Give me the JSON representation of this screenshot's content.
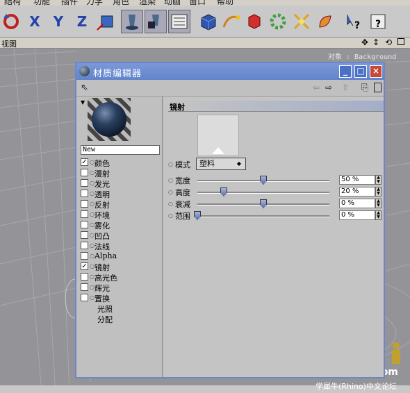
{
  "menubar": {
    "items": [
      "结构",
      "功能",
      "插件",
      "力学",
      "角色",
      "渲染",
      "动画",
      "窗口",
      "帮助"
    ]
  },
  "toolbar": {
    "axis_x": "X",
    "axis_y": "Y",
    "axis_z": "Z"
  },
  "viewbar": {
    "label": "视图"
  },
  "viewport": {
    "object_label": "对象 : Background"
  },
  "material_editor": {
    "title": "材质编辑器",
    "material_name": "New",
    "channels": [
      {
        "label": "颜色",
        "checked": true
      },
      {
        "label": "漫射",
        "checked": false
      },
      {
        "label": "发光",
        "checked": false
      },
      {
        "label": "透明",
        "checked": false
      },
      {
        "label": "反射",
        "checked": false
      },
      {
        "label": "环境",
        "checked": false
      },
      {
        "label": "雾化",
        "checked": false
      },
      {
        "label": "凹凸",
        "checked": false
      },
      {
        "label": "法线",
        "checked": false
      },
      {
        "label": "Alpha",
        "checked": false
      },
      {
        "label": "镜射",
        "checked": true
      },
      {
        "label": "高光色",
        "checked": false
      },
      {
        "label": "辉光",
        "checked": false
      },
      {
        "label": "置换",
        "checked": false
      }
    ],
    "extra_labels": [
      "光照",
      "分配"
    ],
    "section_title": "镜射",
    "mode": {
      "label": "模式",
      "value": "塑料"
    },
    "params": [
      {
        "label": "宽度",
        "value": "50 %",
        "fraction": 0.5
      },
      {
        "label": "高度",
        "value": "20 %",
        "fraction": 0.2
      },
      {
        "label": "衰减",
        "value": "0 %",
        "fraction": 0.5
      },
      {
        "label": "范围",
        "value": "0 %",
        "fraction": 0.0
      }
    ]
  },
  "watermark": {
    "site": "xuexiniu.com",
    "forum": "学犀牛(Rhino)中文论坛"
  }
}
